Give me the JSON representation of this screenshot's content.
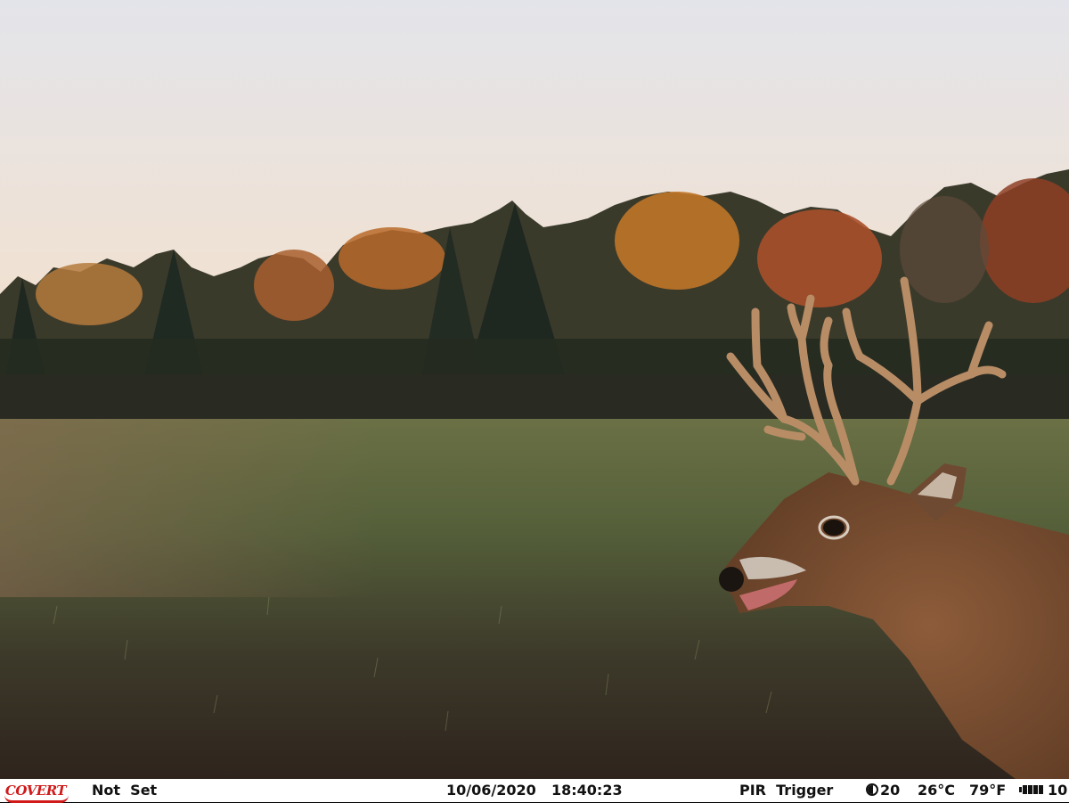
{
  "photo": {
    "subject": "white-tailed buck in field at tree line",
    "colors": {
      "sky_top": "#e6e6ec",
      "sky_bottom": "#f1dcc8",
      "trees_dark": "#2b3327",
      "trees_autumn": "#b8642a",
      "field_grass": "#5c6a3c",
      "field_soil": "#3a2d24",
      "deer_coat": "#8a5a38",
      "antler": "#c9a27a"
    }
  },
  "infobar": {
    "brand": "COVERT",
    "mode": "Not  Set",
    "date": "10/06/2020",
    "time": "18:40:23",
    "trigger": "PIR  Trigger",
    "moon_value": "20",
    "temp_c": "26°C",
    "temp_f": "79°F",
    "battery": "10",
    "icons": [
      "moon-phase-icon",
      "battery-icon"
    ]
  }
}
